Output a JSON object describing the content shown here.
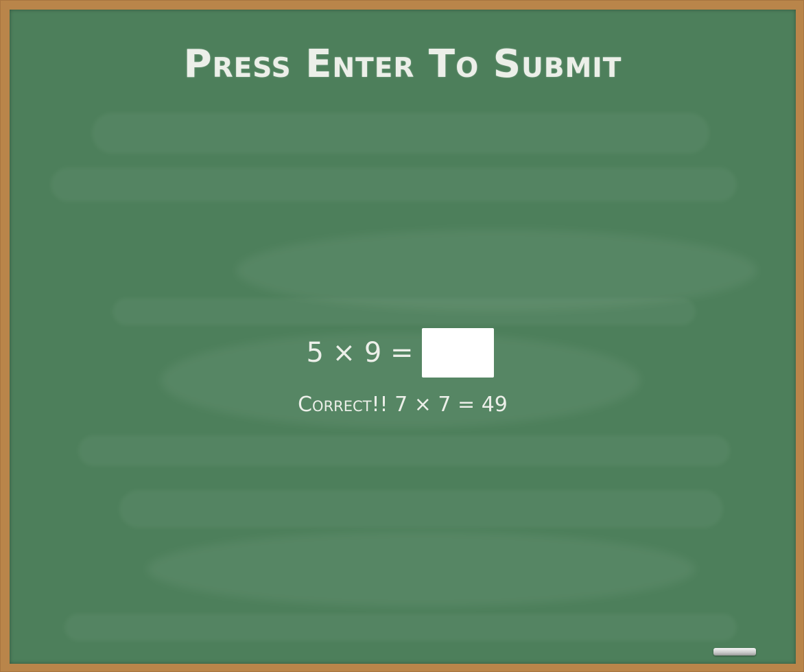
{
  "title": "Press Enter To Submit",
  "problem": {
    "equation": "5 × 9 =",
    "answer_value": ""
  },
  "feedback": "Correct!! 7 × 7 = 49",
  "colors": {
    "frame": "#b9854a",
    "board": "#4d7f5b",
    "chalk": "#ecefe9",
    "input": "#ffffff"
  }
}
